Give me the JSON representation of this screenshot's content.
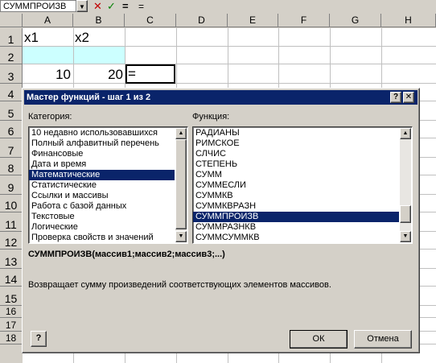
{
  "formula_bar": {
    "name_box": "СУММПРОИЗВ",
    "formula": "="
  },
  "sheet": {
    "columns": [
      "A",
      "B",
      "C",
      "D",
      "E",
      "F",
      "G",
      "H"
    ],
    "rows": [
      "1",
      "2",
      "3",
      "4",
      "5",
      "6",
      "7",
      "8",
      "9",
      "10",
      "11",
      "12",
      "13",
      "14",
      "15",
      "16",
      "17",
      "18"
    ],
    "cells": {
      "a1": "x1",
      "b1": "x2",
      "a3": "10",
      "b3": "20",
      "c3": "="
    },
    "colors": {
      "highlight": "#ccffff"
    }
  },
  "dialog": {
    "title": "Мастер функций - шаг 1 из 2",
    "help_glyph": "?",
    "close_glyph": "✕",
    "category_label": "Категория:",
    "function_label": "Функция:",
    "categories": [
      "10 недавно использовавшихся",
      "Полный алфавитный перечень",
      "Финансовые",
      "Дата и время",
      "Математические",
      "Статистические",
      "Ссылки и массивы",
      "Работа с базой данных",
      "Текстовые",
      "Логические",
      "Проверка свойств и значений"
    ],
    "selected_category": "Математические",
    "functions": [
      "РАДИАНЫ",
      "РИМСКОЕ",
      "СЛЧИС",
      "СТЕПЕНЬ",
      "СУММ",
      "СУММЕСЛИ",
      "СУММКВ",
      "СУММКВРАЗН",
      "СУММПРОИЗВ",
      "СУММРАЗНКВ",
      "СУММСУММКВ"
    ],
    "selected_function": "СУММПРОИЗВ",
    "syntax": "СУММПРОИЗВ(массив1;массив2;массив3;...)",
    "description": "Возвращает сумму произведений соответствующих элементов массивов.",
    "ok_label": "ОК",
    "cancel_label": "Отмена",
    "help_button_glyph": "?"
  }
}
